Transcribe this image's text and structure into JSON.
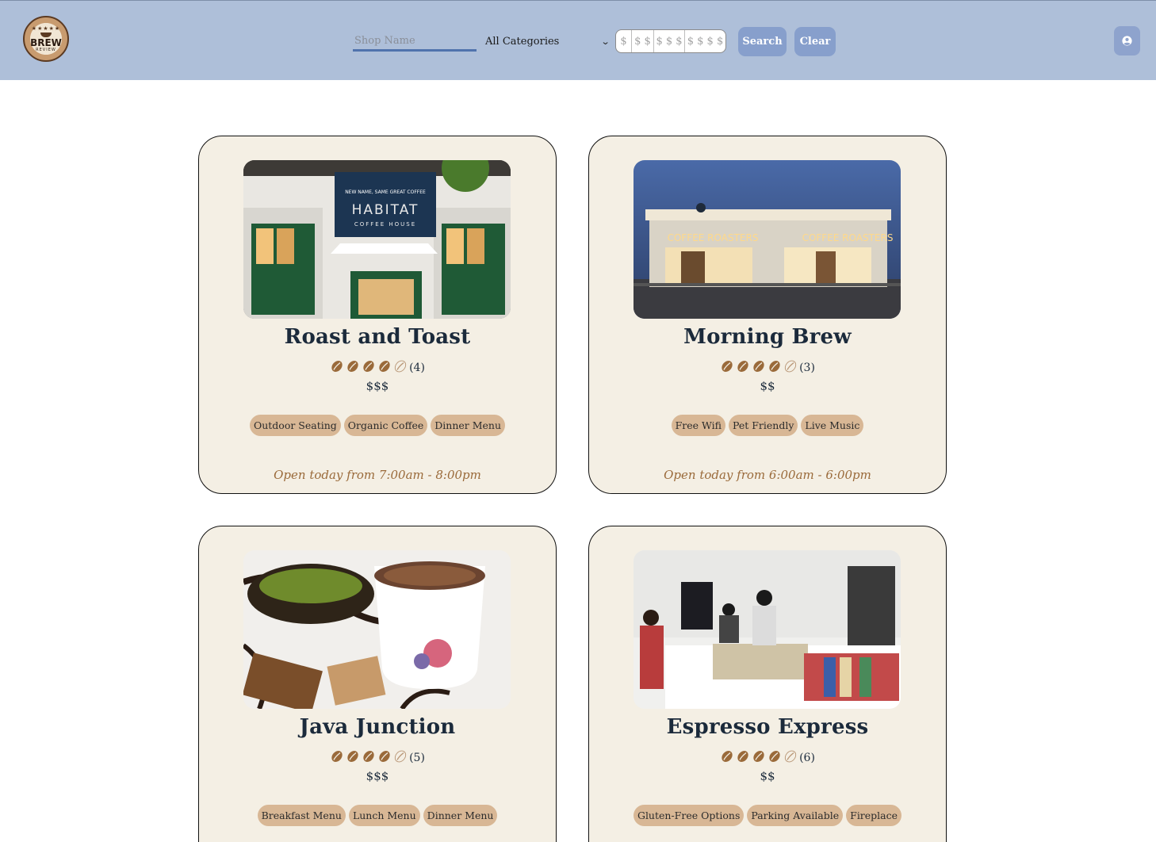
{
  "app": {
    "name": "Brew Review",
    "logo_text": "BREW",
    "logo_subtext": "REVIEW"
  },
  "header": {
    "search": {
      "placeholder": "Shop Name",
      "value": ""
    },
    "category": {
      "selected": "All Categories"
    },
    "price_options": [
      "$",
      "$ $",
      "$ $ $",
      "$ $ $ $"
    ],
    "search_label": "Search",
    "clear_label": "Clear",
    "user_icon": "user-circle-icon"
  },
  "colors": {
    "header_bg": "#aebfd9",
    "card_bg": "#f4efe4",
    "tag_bg": "#d8b795",
    "bean": "#9a6a3a",
    "hours_text": "#9a6a3a",
    "button_bg": "#879fcc"
  },
  "shops": [
    {
      "name": "Roast and Toast",
      "rating": 4,
      "rating_count": "(4)",
      "price": "$$$",
      "tags": [
        "Outdoor Seating",
        "Organic Coffee",
        "Dinner Menu"
      ],
      "hours": "Open today from 7:00am - 8:00pm",
      "image": "storefront-photo"
    },
    {
      "name": "Morning Brew",
      "rating": 4,
      "rating_count": "(3)",
      "price": "$$",
      "tags": [
        "Free Wifi",
        "Pet Friendly",
        "Live Music"
      ],
      "hours": "Open today from 6:00am - 6:00pm",
      "image": "night-storefront-photo"
    },
    {
      "name": "Java Junction",
      "rating": 4,
      "rating_count": "(5)",
      "price": "$$$",
      "tags": [
        "Breakfast Menu",
        "Lunch Menu",
        "Dinner Menu"
      ],
      "hours": "",
      "image": "coffee-and-desserts-photo"
    },
    {
      "name": "Espresso Express",
      "rating": 4,
      "rating_count": "(6)",
      "price": "$$",
      "tags": [
        "Gluten-Free Options",
        "Parking Available",
        "Fireplace"
      ],
      "hours": "",
      "image": "cafe-counter-photo"
    }
  ]
}
